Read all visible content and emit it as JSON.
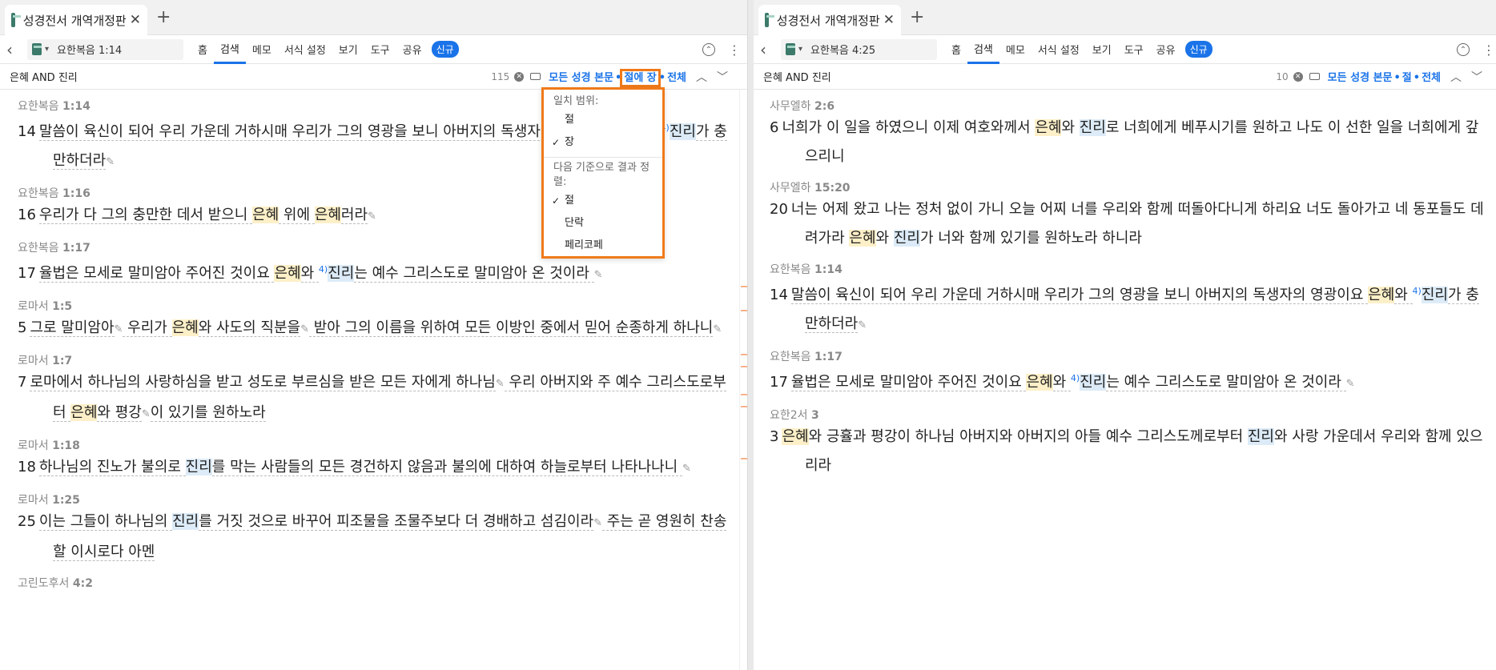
{
  "left": {
    "tab_title": "성경전서 개역개정판",
    "reference": "요한복음 1:14",
    "menu": [
      "홈",
      "검색",
      "메모",
      "서식 설정",
      "보기",
      "도구",
      "공유"
    ],
    "badge": "신규",
    "query": "은혜 AND 진리",
    "count": "115",
    "scope": {
      "all": "모든 성경 본문",
      "verse_chapter": "절에 장",
      "whole": "전체"
    },
    "results": [
      {
        "ref_book": "요한복음",
        "ref_num": "1:14",
        "n": "14",
        "t": [
          [
            "u",
            "말씀이 육신이 되어 우리 가운데 거하시매 우리가 그의 영광을 보니 아버지의 독생자의 영광이요 "
          ],
          [
            "y",
            "은혜"
          ],
          [
            "u",
            "와 "
          ],
          [
            "f",
            "4)"
          ],
          [
            "b",
            "진리"
          ],
          [
            "u",
            "가 충만하더라"
          ],
          [
            "p",
            "✎"
          ]
        ]
      },
      {
        "ref_book": "요한복음",
        "ref_num": "1:16",
        "n": "16",
        "t": [
          [
            "u",
            "우리가 다 그의 충만한 데서 받으니 "
          ],
          [
            "y",
            "은혜"
          ],
          [
            "u",
            " 위에 "
          ],
          [
            "y",
            "은혜"
          ],
          [
            "u",
            "러라"
          ],
          [
            "p",
            "✎"
          ]
        ]
      },
      {
        "ref_book": "요한복음",
        "ref_num": "1:17",
        "n": "17",
        "t": [
          [
            "u",
            "율법은 모세로 말미암아 주어진 것이요 "
          ],
          [
            "y",
            "은혜"
          ],
          [
            "u",
            "와 "
          ],
          [
            "f",
            "4)"
          ],
          [
            "b",
            "진리"
          ],
          [
            "u",
            "는 예수 그리스도로 말미암아 온 것이라 "
          ],
          [
            "p",
            "✎"
          ]
        ]
      },
      {
        "ref_book": "로마서",
        "ref_num": "1:5",
        "n": "5",
        "t": [
          [
            "u",
            "그로 말미암아"
          ],
          [
            "p",
            "✎"
          ],
          [
            "u",
            " 우리가 "
          ],
          [
            "y",
            "은혜"
          ],
          [
            "u",
            "와 사도의 직분을"
          ],
          [
            "p",
            "✎"
          ],
          [
            "u",
            " 받아 그의 이름을 위하여 모든 이방인 중에서 믿어 순종하게 하나니"
          ],
          [
            "p",
            "✎"
          ]
        ]
      },
      {
        "ref_book": "로마서",
        "ref_num": "1:7",
        "n": "7",
        "t": [
          [
            "u",
            "로마에서 하나님의 사랑하심을 받고 성도로 부르심을 받은 모든 자에게 하나님"
          ],
          [
            "p",
            "✎"
          ],
          [
            "u",
            " 우리 아버지와 주 예수 그리스도로부터 "
          ],
          [
            "y",
            "은혜"
          ],
          [
            "u",
            "와 평강"
          ],
          [
            "p",
            "✎"
          ],
          [
            "u",
            "이 있기를 원하노라"
          ]
        ]
      },
      {
        "ref_book": "로마서",
        "ref_num": "1:18",
        "n": "18",
        "t": [
          [
            "u",
            "하나님의 진노가 불의로 "
          ],
          [
            "b",
            "진리"
          ],
          [
            "u",
            "를 막는 사람들의 모든 경건하지 않음과 불의에 대하여 하늘로부터 나타나나니 "
          ],
          [
            "p",
            "✎"
          ]
        ]
      },
      {
        "ref_book": "로마서",
        "ref_num": "1:25",
        "n": "25",
        "t": [
          [
            "u",
            "이는 그들이 하나님의 "
          ],
          [
            "b",
            "진리"
          ],
          [
            "u",
            "를 거짓 것으로 바꾸어 피조물을 조물주보다 더 경배하고 섬김이라"
          ],
          [
            "p",
            "✎"
          ],
          [
            "u",
            " 주는 곧 영원히 찬송할 이시로다 아멘"
          ]
        ]
      },
      {
        "ref_book": "고린도후서",
        "ref_num": "4:2",
        "n": "",
        "t": []
      }
    ],
    "dropdown": {
      "match_header": "일치 범위:",
      "match_items": [
        {
          "label": "절",
          "checked": false
        },
        {
          "label": "장",
          "checked": true
        }
      ],
      "sort_header": "다음 기준으로 결과 정렬:",
      "sort_items": [
        {
          "label": "절",
          "checked": true
        },
        {
          "label": "단락",
          "checked": false
        },
        {
          "label": "페리코페",
          "checked": false
        }
      ]
    }
  },
  "right": {
    "tab_title": "성경전서 개역개정판",
    "reference": "요한복음 4:25",
    "menu": [
      "홈",
      "검색",
      "메모",
      "서식 설정",
      "보기",
      "도구",
      "공유"
    ],
    "badge": "신규",
    "query": "은혜 AND 진리",
    "count": "10",
    "scope": {
      "all": "모든 성경 본문",
      "verse": "절",
      "whole": "전체"
    },
    "results": [
      {
        "ref_book": "사무엘하",
        "ref_num": "2:6",
        "n": "6",
        "t": [
          [
            "t",
            "너희가 이 일을 하였으니 이제 여호와께서 "
          ],
          [
            "y",
            "은혜"
          ],
          [
            "t",
            "와 "
          ],
          [
            "b",
            "진리"
          ],
          [
            "t",
            "로 너희에게 베푸시기를 원하고 나도 이 선한 일을 너희에게 갚으리니"
          ]
        ]
      },
      {
        "ref_book": "사무엘하",
        "ref_num": "15:20",
        "n": "20",
        "t": [
          [
            "t",
            "너는 어제 왔고 나는 정처 없이 가니 오늘 어찌 너를 우리와 함께 떠돌아다니게 하리요 너도 돌아가고 네 동포들도 데려가라 "
          ],
          [
            "y",
            "은혜"
          ],
          [
            "t",
            "와 "
          ],
          [
            "b",
            "진리"
          ],
          [
            "t",
            "가 너와 함께 있기를 원하노라 하니라"
          ]
        ]
      },
      {
        "ref_book": "요한복음",
        "ref_num": "1:14",
        "n": "14",
        "t": [
          [
            "u",
            "말씀이 육신이 되어 우리 가운데 거하시매 우리가 그의 영광을 보니 아버지의 독생자의 영광이요 "
          ],
          [
            "y",
            "은혜"
          ],
          [
            "u",
            "와 "
          ],
          [
            "f",
            "4)"
          ],
          [
            "b",
            "진리"
          ],
          [
            "u",
            "가 충만하더라"
          ],
          [
            "p",
            "✎"
          ]
        ]
      },
      {
        "ref_book": "요한복음",
        "ref_num": "1:17",
        "n": "17",
        "t": [
          [
            "u",
            "율법은 모세로 말미암아 주어진 것이요 "
          ],
          [
            "y",
            "은혜"
          ],
          [
            "u",
            "와 "
          ],
          [
            "f",
            "4)"
          ],
          [
            "b",
            "진리"
          ],
          [
            "u",
            "는 예수 그리스도로 말미암아 온 것이라 "
          ],
          [
            "p",
            "✎"
          ]
        ]
      },
      {
        "ref_book": "요한2서",
        "ref_num": "3",
        "n": "3",
        "t": [
          [
            "y",
            "은혜"
          ],
          [
            "t",
            "와 긍휼과 평강이 하나님 아버지와 아버지의 아들 예수 그리스도께로부터 "
          ],
          [
            "b",
            "진리"
          ],
          [
            "t",
            "와 사랑 가운데서 우리와 함께 있으리라"
          ]
        ]
      }
    ]
  }
}
